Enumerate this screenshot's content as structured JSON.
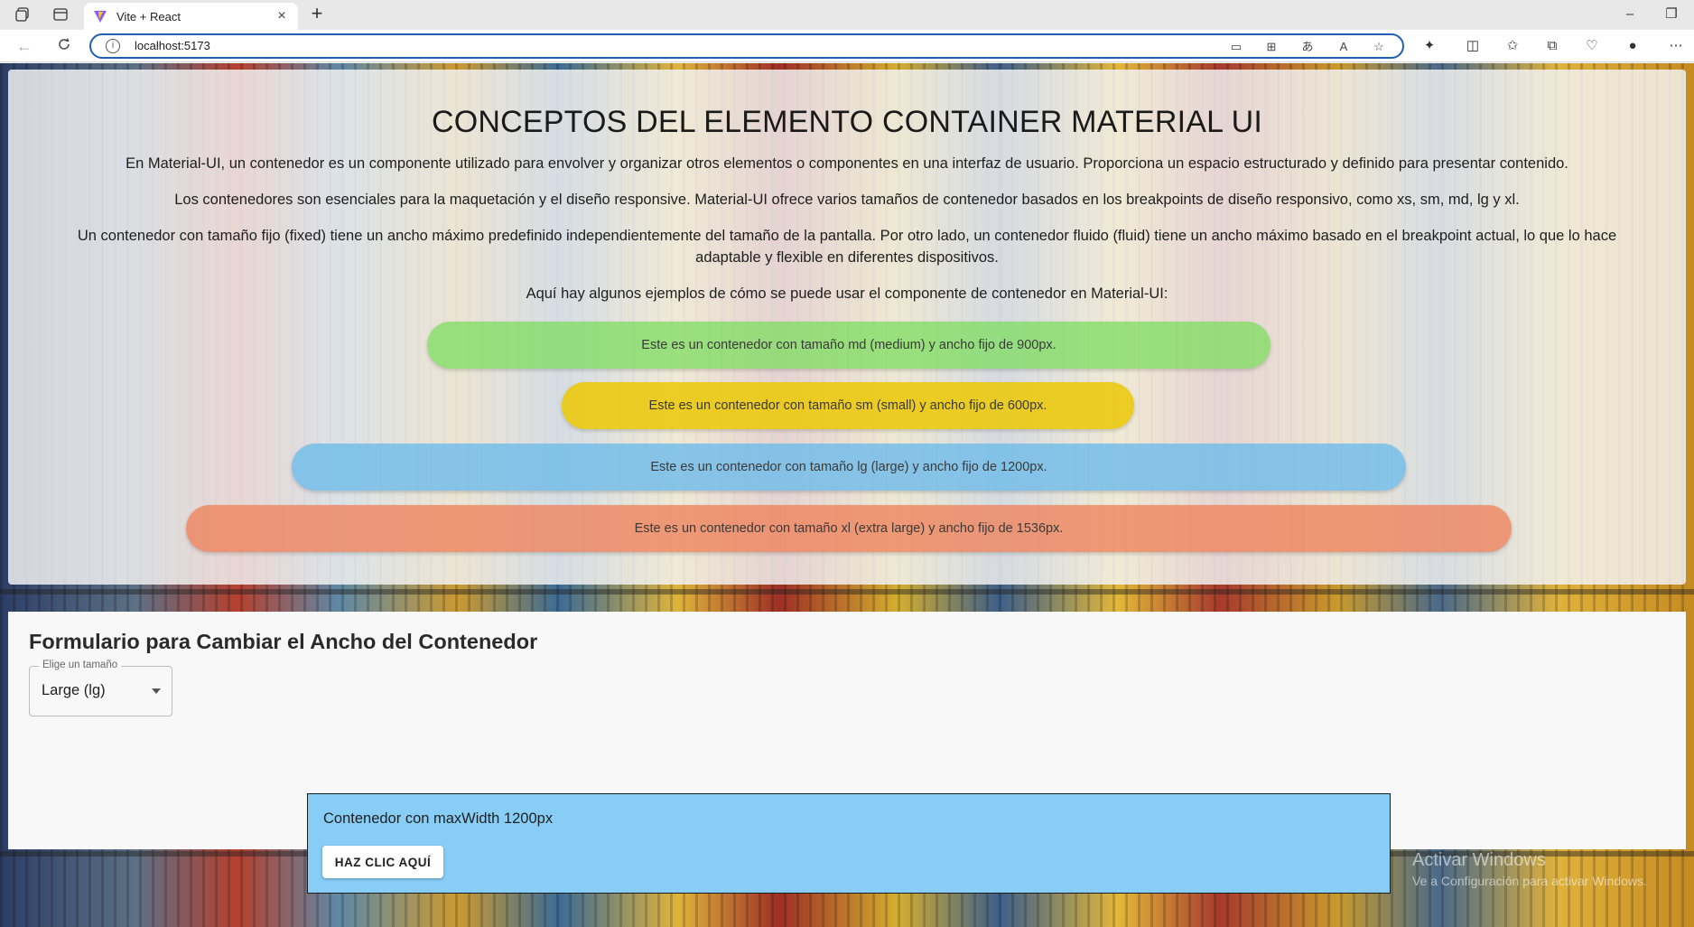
{
  "browser": {
    "tab_title": "Vite + React",
    "tab_close": "×",
    "new_tab": "+",
    "url": "localhost:5173",
    "window_controls": {
      "minimize": "–",
      "restore": "❐"
    }
  },
  "page": {
    "title": "CONCEPTOS DEL ELEMENTO CONTAINER MATERIAL UI",
    "paragraphs": [
      "En Material-UI, un contenedor es un componente utilizado para envolver y organizar otros elementos o componentes en una interfaz de usuario. Proporciona un espacio estructurado y definido para presentar contenido.",
      "Los contenedores son esenciales para la maquetación y el diseño responsive. Material-UI ofrece varios tamaños de contenedor basados en los breakpoints de diseño responsivo, como xs, sm, md, lg y xl.",
      "Un contenedor con tamaño fijo (fixed) tiene un ancho máximo predefinido independientemente del tamaño de la pantalla. Por otro lado, un contenedor fluido (fluid) tiene un ancho máximo basado en el breakpoint actual, lo que lo hace adaptable y flexible en diferentes dispositivos.",
      "Aquí hay algunos ejemplos de cómo se puede usar el componente de contenedor en Material-UI:"
    ],
    "examples": {
      "md": "Este es un contenedor con tamaño md (medium) y ancho fijo de 900px.",
      "sm": "Este es un contenedor con tamaño sm (small) y ancho fijo de 600px.",
      "lg": "Este es un contenedor con tamaño lg (large) y ancho fijo de 1200px.",
      "xl": "Este es un contenedor con tamaño xl (extra large) y ancho fijo de 1536px."
    },
    "colors": {
      "md": "#78dc5a",
      "sm": "#ecc80a",
      "lg": "#78bee8",
      "xl": "#ee825a",
      "demo_box": "#87cdf6"
    }
  },
  "form": {
    "title": "Formulario para Cambiar el Ancho del Contenedor",
    "select_label": "Elige un tamaño",
    "select_value": "Large (lg)",
    "demo_text": "Contenedor con maxWidth 1200px",
    "button_label": "HAZ CLIC AQUÍ"
  },
  "watermark": {
    "line1": "Activar Windows",
    "line2": "Ve a Configuración para activar Windows."
  }
}
